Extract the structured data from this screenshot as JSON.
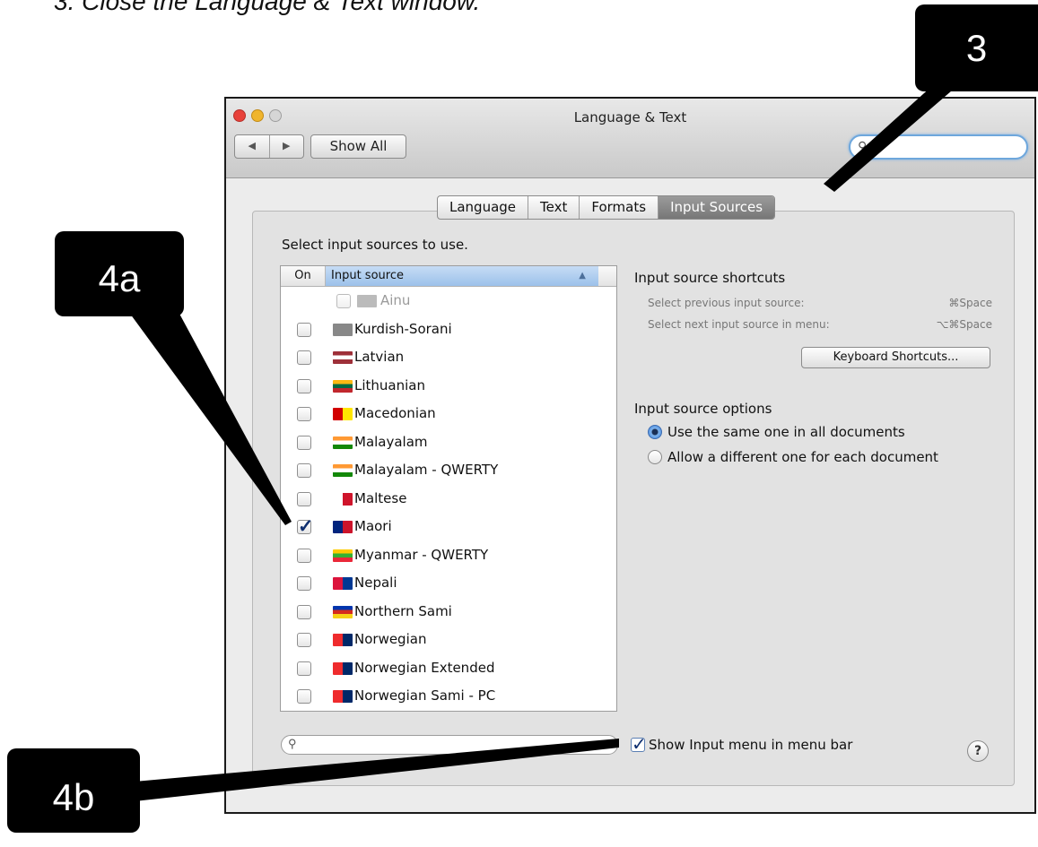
{
  "caption": "3. Close the Language & Text window.",
  "window": {
    "title": "Language & Text",
    "nav_back": "◀",
    "nav_forward": "▶",
    "show_all": "Show All",
    "search_placeholder": ""
  },
  "tabs": [
    {
      "label": "Language",
      "selected": false
    },
    {
      "label": "Text",
      "selected": false
    },
    {
      "label": "Formats",
      "selected": false
    },
    {
      "label": "Input Sources",
      "selected": true
    }
  ],
  "select_label": "Select input sources to use.",
  "list": {
    "col_on": "On",
    "col_source": "Input source",
    "rows": [
      {
        "name": "Ainu",
        "checked": false,
        "disabled": true,
        "icon": "ainu-keyboard-icon",
        "flag": [
          "#bbbbbb"
        ]
      },
      {
        "name": "Kurdish-Sorani",
        "checked": false,
        "icon": "keyboard-icon",
        "flag": [
          "#888"
        ]
      },
      {
        "name": "Latvian",
        "checked": false,
        "icon": "latvia-flag-icon",
        "flag": [
          "#9e3039",
          "#ffffff",
          "#9e3039"
        ]
      },
      {
        "name": "Lithuanian",
        "checked": false,
        "icon": "lithuania-flag-icon",
        "flag": [
          "#fdb913",
          "#006a44",
          "#c1272d"
        ]
      },
      {
        "name": "Macedonian",
        "checked": false,
        "icon": "macedonia-flag-icon",
        "flag": [
          "#d20000",
          "#ffe600"
        ]
      },
      {
        "name": "Malayalam",
        "checked": false,
        "icon": "malayalam-script-icon",
        "flag": [
          "#ff9933",
          "#ffffff",
          "#138808"
        ]
      },
      {
        "name": "Malayalam - QWERTY",
        "checked": false,
        "icon": "malayalam-qwerty-icon",
        "flag": [
          "#ff9933",
          "#ffffff",
          "#138808"
        ]
      },
      {
        "name": "Maltese",
        "checked": false,
        "icon": "malta-flag-icon",
        "flag": [
          "#ffffff",
          "#cf142b"
        ]
      },
      {
        "name": "Maori",
        "checked": true,
        "icon": "new-zealand-flag-icon",
        "flag": [
          "#00247d",
          "#cc142b"
        ]
      },
      {
        "name": "Myanmar - QWERTY",
        "checked": false,
        "icon": "myanmar-flag-icon",
        "flag": [
          "#fecb00",
          "#34b233",
          "#ea2839"
        ]
      },
      {
        "name": "Nepali",
        "checked": false,
        "icon": "nepal-flag-icon",
        "flag": [
          "#dc143c",
          "#003893"
        ]
      },
      {
        "name": "Northern Sami",
        "checked": false,
        "icon": "sami-flag-icon",
        "flag": [
          "#0035ad",
          "#d52b1e",
          "#f7d117"
        ]
      },
      {
        "name": "Norwegian",
        "checked": false,
        "icon": "norway-flag-icon",
        "flag": [
          "#ef2b2d",
          "#002868"
        ]
      },
      {
        "name": "Norwegian Extended",
        "checked": false,
        "icon": "norway-extended-flag-icon",
        "flag": [
          "#ef2b2d",
          "#002868"
        ]
      },
      {
        "name": "Norwegian Sami - PC",
        "checked": false,
        "icon": "norway-sami-flag-icon",
        "flag": [
          "#ef2b2d",
          "#002868"
        ]
      }
    ]
  },
  "shortcuts": {
    "title": "Input source shortcuts",
    "prev_label": "Select previous input source:",
    "prev_key": "⌘Space",
    "next_label": "Select next input source in menu:",
    "next_key": "⌥⌘Space",
    "button": "Keyboard Shortcuts..."
  },
  "options": {
    "title": "Input source options",
    "same": "Use the same one in all documents",
    "different": "Allow a different one for each document",
    "selected": "same"
  },
  "bottom": {
    "search_placeholder": "",
    "show_input_menu": "Show Input menu in menu bar",
    "show_input_checked": true,
    "help": "?"
  },
  "callouts": {
    "c3": "3",
    "c4a": "4a",
    "c4b": "4b"
  }
}
